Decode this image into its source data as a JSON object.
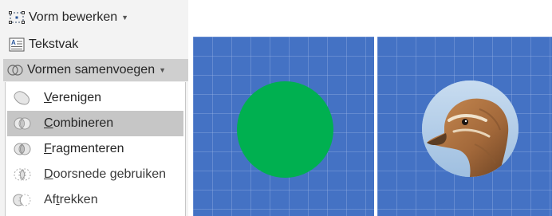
{
  "ribbon": {
    "edit_shape_label": "Vorm bewerken",
    "textbox_label": "Tekstvak",
    "merge_shapes_label": "Vormen samenvoegen"
  },
  "merge_menu": {
    "items": [
      {
        "first": "V",
        "rest": "erenigen",
        "icon": "union-icon"
      },
      {
        "first": "C",
        "rest": "ombineren",
        "icon": "combine-icon",
        "selected": true
      },
      {
        "first": "F",
        "rest": "ragmenteren",
        "icon": "fragment-icon"
      },
      {
        "first": "D",
        "rest": "oorsnede gebruiken",
        "icon": "intersect-icon"
      },
      {
        "pre": "Af",
        "first": "t",
        "rest": "rekken",
        "icon": "subtract-icon"
      }
    ]
  },
  "colors": {
    "slide_bg": "#4472c4",
    "green_shape": "#00b050",
    "ribbon_bg": "#f3f3f3",
    "hover": "#c6c6c6"
  },
  "slides": [
    {
      "content": "green-circle"
    },
    {
      "content": "duck-photo-circle"
    }
  ]
}
